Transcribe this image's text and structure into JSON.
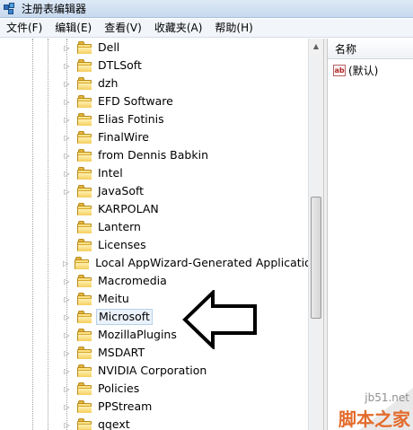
{
  "window": {
    "title": "注册表编辑器",
    "icon": "registry-editor-icon"
  },
  "menu": [
    {
      "label": "文件(F)"
    },
    {
      "label": "编辑(E)"
    },
    {
      "label": "查看(V)"
    },
    {
      "label": "收藏夹(A)"
    },
    {
      "label": "帮助(H)"
    }
  ],
  "tree": {
    "items": [
      {
        "label": "Dell",
        "expandable": true
      },
      {
        "label": "DTLSoft",
        "expandable": true
      },
      {
        "label": "dzh",
        "expandable": true
      },
      {
        "label": "EFD Software",
        "expandable": true
      },
      {
        "label": "Elias Fotinis",
        "expandable": true
      },
      {
        "label": "FinalWire",
        "expandable": true
      },
      {
        "label": "from Dennis Babkin",
        "expandable": true
      },
      {
        "label": "Intel",
        "expandable": true
      },
      {
        "label": "JavaSoft",
        "expandable": true
      },
      {
        "label": "KARPOLAN",
        "expandable": false
      },
      {
        "label": "Lantern",
        "expandable": false
      },
      {
        "label": "Licenses",
        "expandable": false
      },
      {
        "label": "Local AppWizard-Generated Applications",
        "expandable": true
      },
      {
        "label": "Macromedia",
        "expandable": true
      },
      {
        "label": "Meitu",
        "expandable": true
      },
      {
        "label": "Microsoft",
        "expandable": true,
        "selected": true
      },
      {
        "label": "MozillaPlugins",
        "expandable": true
      },
      {
        "label": "MSDART",
        "expandable": true
      },
      {
        "label": "NVIDIA Corporation",
        "expandable": true
      },
      {
        "label": "Policies",
        "expandable": true
      },
      {
        "label": "PPStream",
        "expandable": true
      },
      {
        "label": "qqext",
        "expandable": true
      }
    ]
  },
  "values_pane": {
    "column_header": "名称",
    "rows": [
      {
        "icon": "string-value-icon",
        "label": "(默认)",
        "icon_text": "ab"
      }
    ]
  },
  "watermark": {
    "domain": "jb51.net",
    "name": "脚本之家"
  },
  "colors": {
    "selection_border": "#b7cfe9",
    "arrow": "#000000",
    "watermark_accent": "#e36b2c"
  }
}
